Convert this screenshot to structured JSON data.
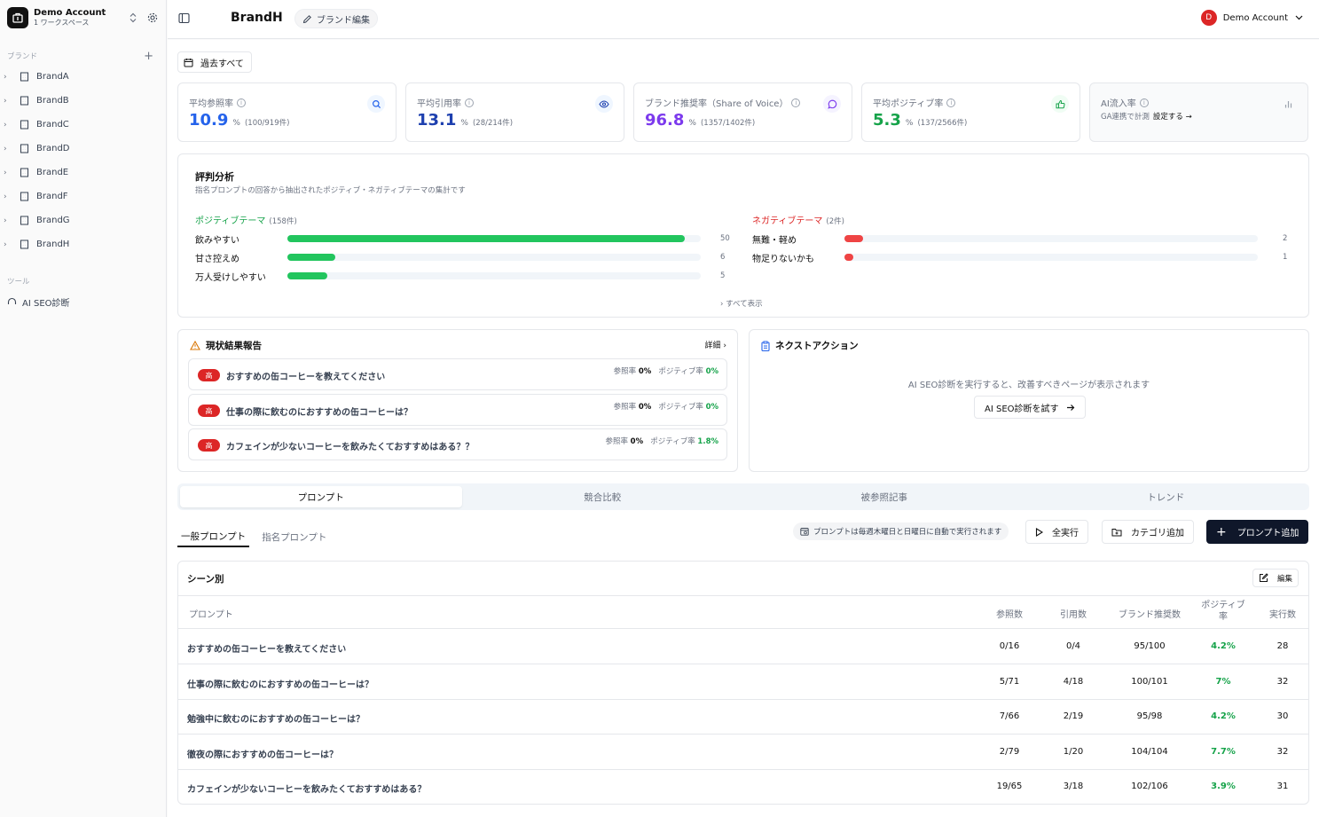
{
  "workspace": {
    "name": "Demo Account",
    "sub": "1 ワークスペース"
  },
  "sidebar": {
    "brands_label": "ブランド",
    "brands": [
      "BrandA",
      "BrandB",
      "BrandC",
      "BrandD",
      "BrandE",
      "BrandF",
      "BrandG",
      "BrandH"
    ],
    "tools_label": "ツール",
    "tools": [
      "AI SEO診断"
    ]
  },
  "header": {
    "brand": "BrandH",
    "edit_label": "ブランド編集",
    "account": "Demo Account",
    "avatar_letter": "D"
  },
  "period": {
    "label": "過去すべて"
  },
  "kpis": [
    {
      "label": "平均参照率",
      "value": "10.9",
      "unit": "%",
      "detail": "(100/919件)",
      "color": "#2563eb"
    },
    {
      "label": "平均引用率",
      "value": "13.1",
      "unit": "%",
      "detail": "(28/214件)",
      "color": "#1e40af"
    },
    {
      "label": "ブランド推奨率（Share of Voice）",
      "value": "96.8",
      "unit": "%",
      "detail": "(1357/1402件)",
      "color": "#7c3aed"
    },
    {
      "label": "平均ポジティブ率",
      "value": "5.3",
      "unit": "%",
      "detail": "(137/2566件)",
      "color": "#16a34a"
    },
    {
      "label": "AI流入率",
      "sub": "GA連携で計測",
      "link": "設定する →"
    }
  ],
  "reputation": {
    "title": "評判分析",
    "subtitle": "指名プロンプトの回答から抽出されたポジティブ・ネガティブテーマの集計です",
    "positive_label": "ポジティブテーマ",
    "positive_count": "(158件)",
    "negative_label": "ネガティブテーマ",
    "negative_count": "(2件)",
    "positive": [
      {
        "label": "飲みやすい",
        "count": 50
      },
      {
        "label": "甘さ控えめ",
        "count": 6
      },
      {
        "label": "万人受けしやすい",
        "count": 5
      }
    ],
    "negative": [
      {
        "label": "無難・軽め",
        "count": 2
      },
      {
        "label": "物足りないかも",
        "count": 1
      }
    ],
    "positive_scale_max": 52,
    "negative_scale_max": 45,
    "show_all": "すべて表示"
  },
  "status": {
    "title": "現状結果報告",
    "detail": "詳細",
    "rows": [
      {
        "badge": "高",
        "q": "おすすめの缶コーヒーを教えてください",
        "ref_label": "参照率",
        "ref": "0%",
        "pos_label": "ポジティブ率",
        "pos": "0%"
      },
      {
        "badge": "高",
        "q": "仕事の際に飲むのにおすすめの缶コーヒーは？",
        "ref_label": "参照率",
        "ref": "0%",
        "pos_label": "ポジティブ率",
        "pos": "0%"
      },
      {
        "badge": "高",
        "q": "カフェインが少ないコーヒーを飲みたくておすすめはある？？",
        "ref_label": "参照率",
        "ref": "0%",
        "pos_label": "ポジティブ率",
        "pos": "1.8%"
      }
    ]
  },
  "next_action": {
    "title": "ネクストアクション",
    "message": "AI SEO診断を実行すると、改善すべきページが表示されます",
    "button": "AI SEO診断を試す"
  },
  "tabs": [
    "プロンプト",
    "競合比較",
    "被参照記事",
    "トレンド"
  ],
  "subtabs": [
    "一般プロンプト",
    "指名プロンプト"
  ],
  "notice": "プロンプトは毎週木曜日と日曜日に自動で実行されます",
  "actions": {
    "run_all": "全実行",
    "add_category": "カテゴリ追加",
    "add_prompt": "プロンプト追加"
  },
  "table": {
    "title": "シーン別",
    "edit": "編集",
    "columns": [
      "プロンプト",
      "参照数",
      "引用数",
      "ブランド推奨数",
      "ポジティブ率",
      "実行数"
    ],
    "rows": [
      [
        "おすすめの缶コーヒーを教えてください",
        "0/16",
        "0/4",
        "95/100",
        "4.2%",
        "28"
      ],
      [
        "仕事の際に飲むのにおすすめの缶コーヒーは？",
        "5/71",
        "4/18",
        "100/101",
        "7%",
        "32"
      ],
      [
        "勉強中に飲むのにおすすめの缶コーヒーは？",
        "7/66",
        "2/19",
        "95/98",
        "4.2%",
        "30"
      ],
      [
        "徹夜の際におすすめの缶コーヒーは？",
        "2/79",
        "1/20",
        "104/104",
        "7.7%",
        "32"
      ],
      [
        "カフェインが少ないコーヒーを飲みたくておすすめはある？",
        "19/65",
        "3/18",
        "102/106",
        "3.9%",
        "31"
      ]
    ]
  }
}
